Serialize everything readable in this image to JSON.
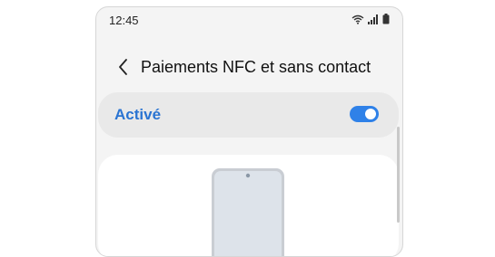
{
  "status_bar": {
    "time": "12:45",
    "icons": [
      "wifi-icon",
      "signal-icon",
      "battery-icon"
    ]
  },
  "header": {
    "back_icon": "chevron-left-icon",
    "title": "Paiements NFC et sans contact"
  },
  "toggle": {
    "label": "Activé",
    "state": true
  },
  "illustration": {
    "icon": "phone-on-terminal-illustration"
  },
  "colors": {
    "accent": "#2f81e8",
    "label_blue": "#2a74d2",
    "background": "#f4f4f4",
    "card": "#e9e9e9"
  }
}
